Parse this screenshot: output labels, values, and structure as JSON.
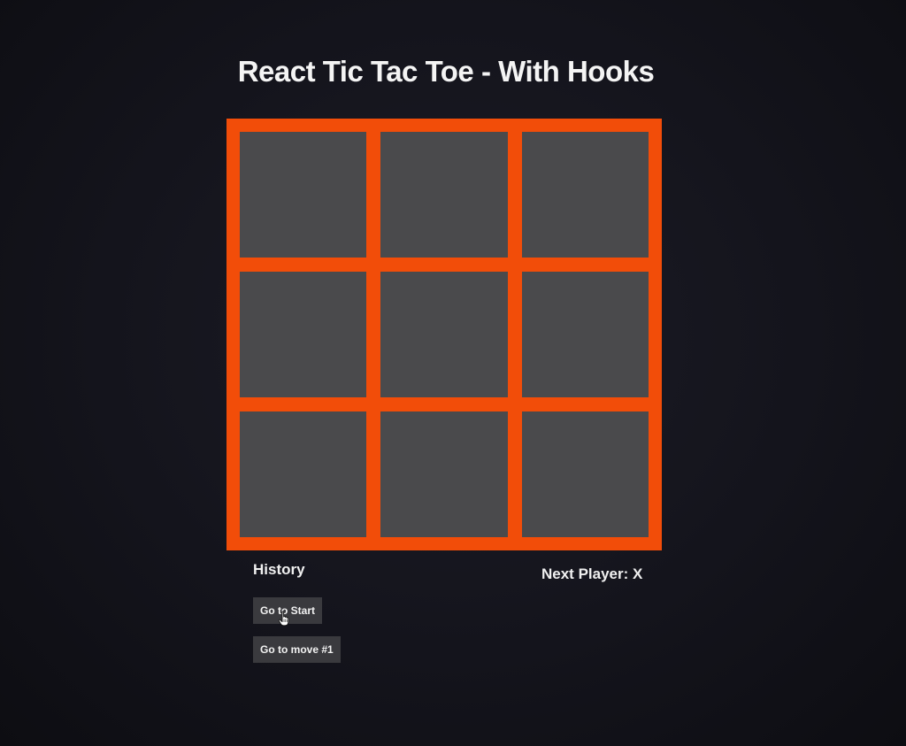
{
  "page": {
    "title": "React Tic Tac Toe - With Hooks"
  },
  "board": {
    "squares": [
      "",
      "",
      "",
      "",
      "",
      "",
      "",
      "",
      ""
    ],
    "border_color": "#f24d09",
    "square_color": "#4a4a4c"
  },
  "history": {
    "heading": "History",
    "moves": [
      {
        "label": "Go to Start"
      },
      {
        "label": "Go to move #1"
      }
    ]
  },
  "status": {
    "text": "Next Player: X"
  },
  "cursor": {
    "icon": "hand-pointer-icon"
  }
}
